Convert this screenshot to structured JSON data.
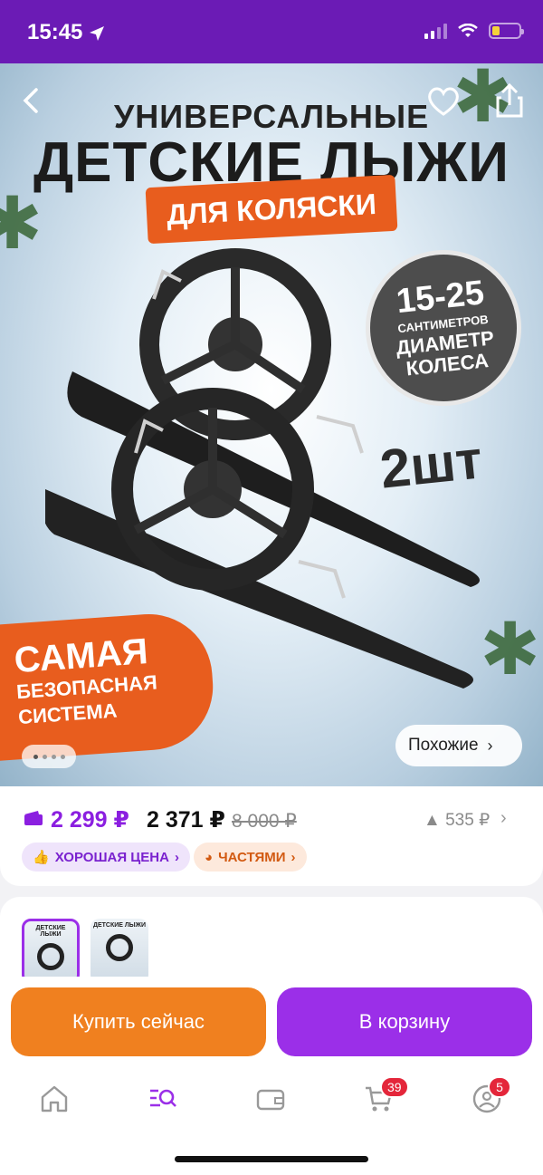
{
  "status": {
    "time": "15:45",
    "battery_level": 0.3
  },
  "hero": {
    "title_line1": "УНИВЕРСАЛЬНЫЕ",
    "title_line2": "ДЕТСКИЕ ЛЫЖИ",
    "tag": "ДЛЯ КОЛЯСКИ",
    "circle_big": "15-25",
    "circle_small": "САНТИМЕТРОВ",
    "circle_caption1": "ДИАМЕТР",
    "circle_caption2": "КОЛЕСА",
    "pieces": "2шт",
    "promo_line1": "САМАЯ",
    "promo_line2": "БЕЗОПАСНАЯ",
    "promo_line3": "СИСТЕМА",
    "similar_label": "Похожие",
    "slides_total": 4,
    "slide_active": 1
  },
  "price": {
    "wallet_price": "2 299 ₽",
    "price": "2 371 ₽",
    "old_price": "8 000 ₽",
    "delta": "▲ 535 ₽",
    "badge_good_price": "ХОРОШАЯ ЦЕНА",
    "badge_installments": "ЧАСТЯМИ"
  },
  "thumbs": [
    {
      "text": "ДЕТСКИЕ ЛЫЖИ",
      "selected": true
    },
    {
      "text": "ДЕТСКИЕ ЛЫЖИ",
      "selected": false
    }
  ],
  "actions": {
    "buy_now": "Купить сейчас",
    "add_to_cart": "В корзину"
  },
  "tabbar": {
    "items": [
      "home-icon",
      "catalog-search-icon",
      "wallet-icon",
      "cart-icon",
      "profile-icon"
    ],
    "cart_count": "39",
    "profile_count": "5"
  },
  "colors": {
    "brand_purple": "#9b2fe8",
    "status_bar": "#6b1bb5",
    "orange": "#f0801f",
    "badge_red": "#e4263a"
  }
}
